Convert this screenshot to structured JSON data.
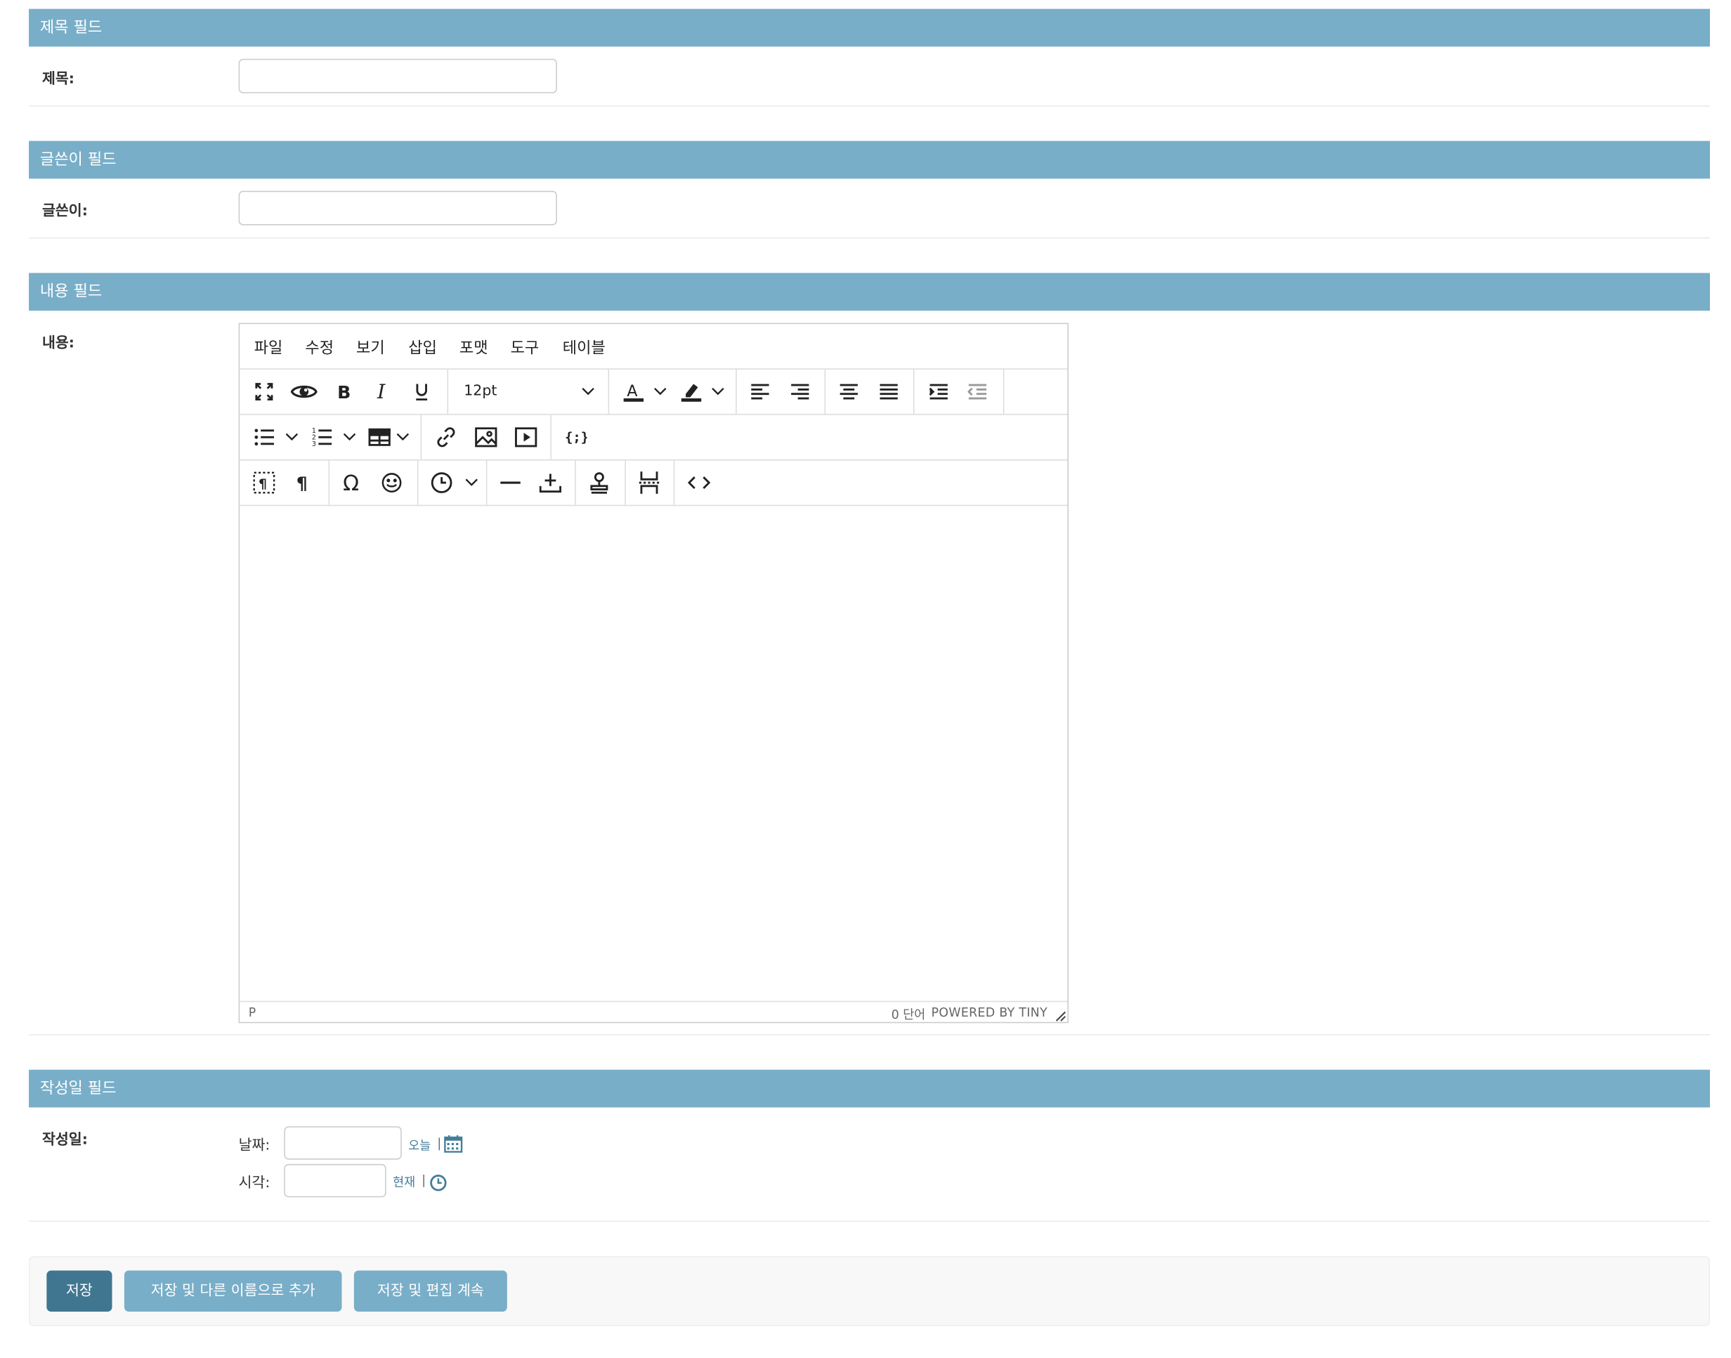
{
  "sections": {
    "title": {
      "header": "제목 필드",
      "label": "제목:",
      "value": ""
    },
    "author": {
      "header": "글쓴이 필드",
      "label": "글쓴이:",
      "value": ""
    },
    "content": {
      "header": "내용 필드",
      "label": "내용:"
    },
    "created": {
      "header": "작성일 필드",
      "label": "작성일:"
    }
  },
  "editor": {
    "menu": [
      "파일",
      "수정",
      "보기",
      "삽입",
      "포맷",
      "도구",
      "테이블"
    ],
    "font_size": "12pt",
    "toolbar_icons": {
      "row1": [
        "fullscreen-icon",
        "preview-icon",
        "bold-icon",
        "italic-icon",
        "underline-icon",
        "font-size-select",
        "text-color-icon",
        "highlight-color-icon",
        "align-left-icon",
        "align-right-icon",
        "align-center-icon",
        "align-justify-icon",
        "indent-icon",
        "outdent-icon"
      ],
      "row2": [
        "bullet-list-icon",
        "numbered-list-icon",
        "table-icon",
        "link-icon",
        "image-icon",
        "media-icon",
        "template-icon"
      ],
      "row3": [
        "visual-blocks-icon",
        "visual-chars-icon",
        "special-char-icon",
        "emoticons-icon",
        "insert-datetime-icon",
        "horizontal-rule-icon",
        "anchor-icon",
        "nonbreaking-icon",
        "pagebreak-icon",
        "code-icon"
      ]
    },
    "status": {
      "path": "P",
      "word_count": "0 단어",
      "brand": "POWERED BY TINY"
    }
  },
  "datetime": {
    "date_label": "날짜:",
    "date_value": "",
    "today_link": "오늘",
    "time_label": "시각:",
    "time_value": "",
    "now_link": "현재",
    "separator": "|"
  },
  "buttons": {
    "save": "저장",
    "save_add_another": "저장 및 다른 이름으로 추가",
    "save_continue": "저장 및 편집 계속"
  },
  "colors": {
    "section_header": "#79aec8",
    "primary_button": "#417690",
    "link": "#447e9b"
  }
}
